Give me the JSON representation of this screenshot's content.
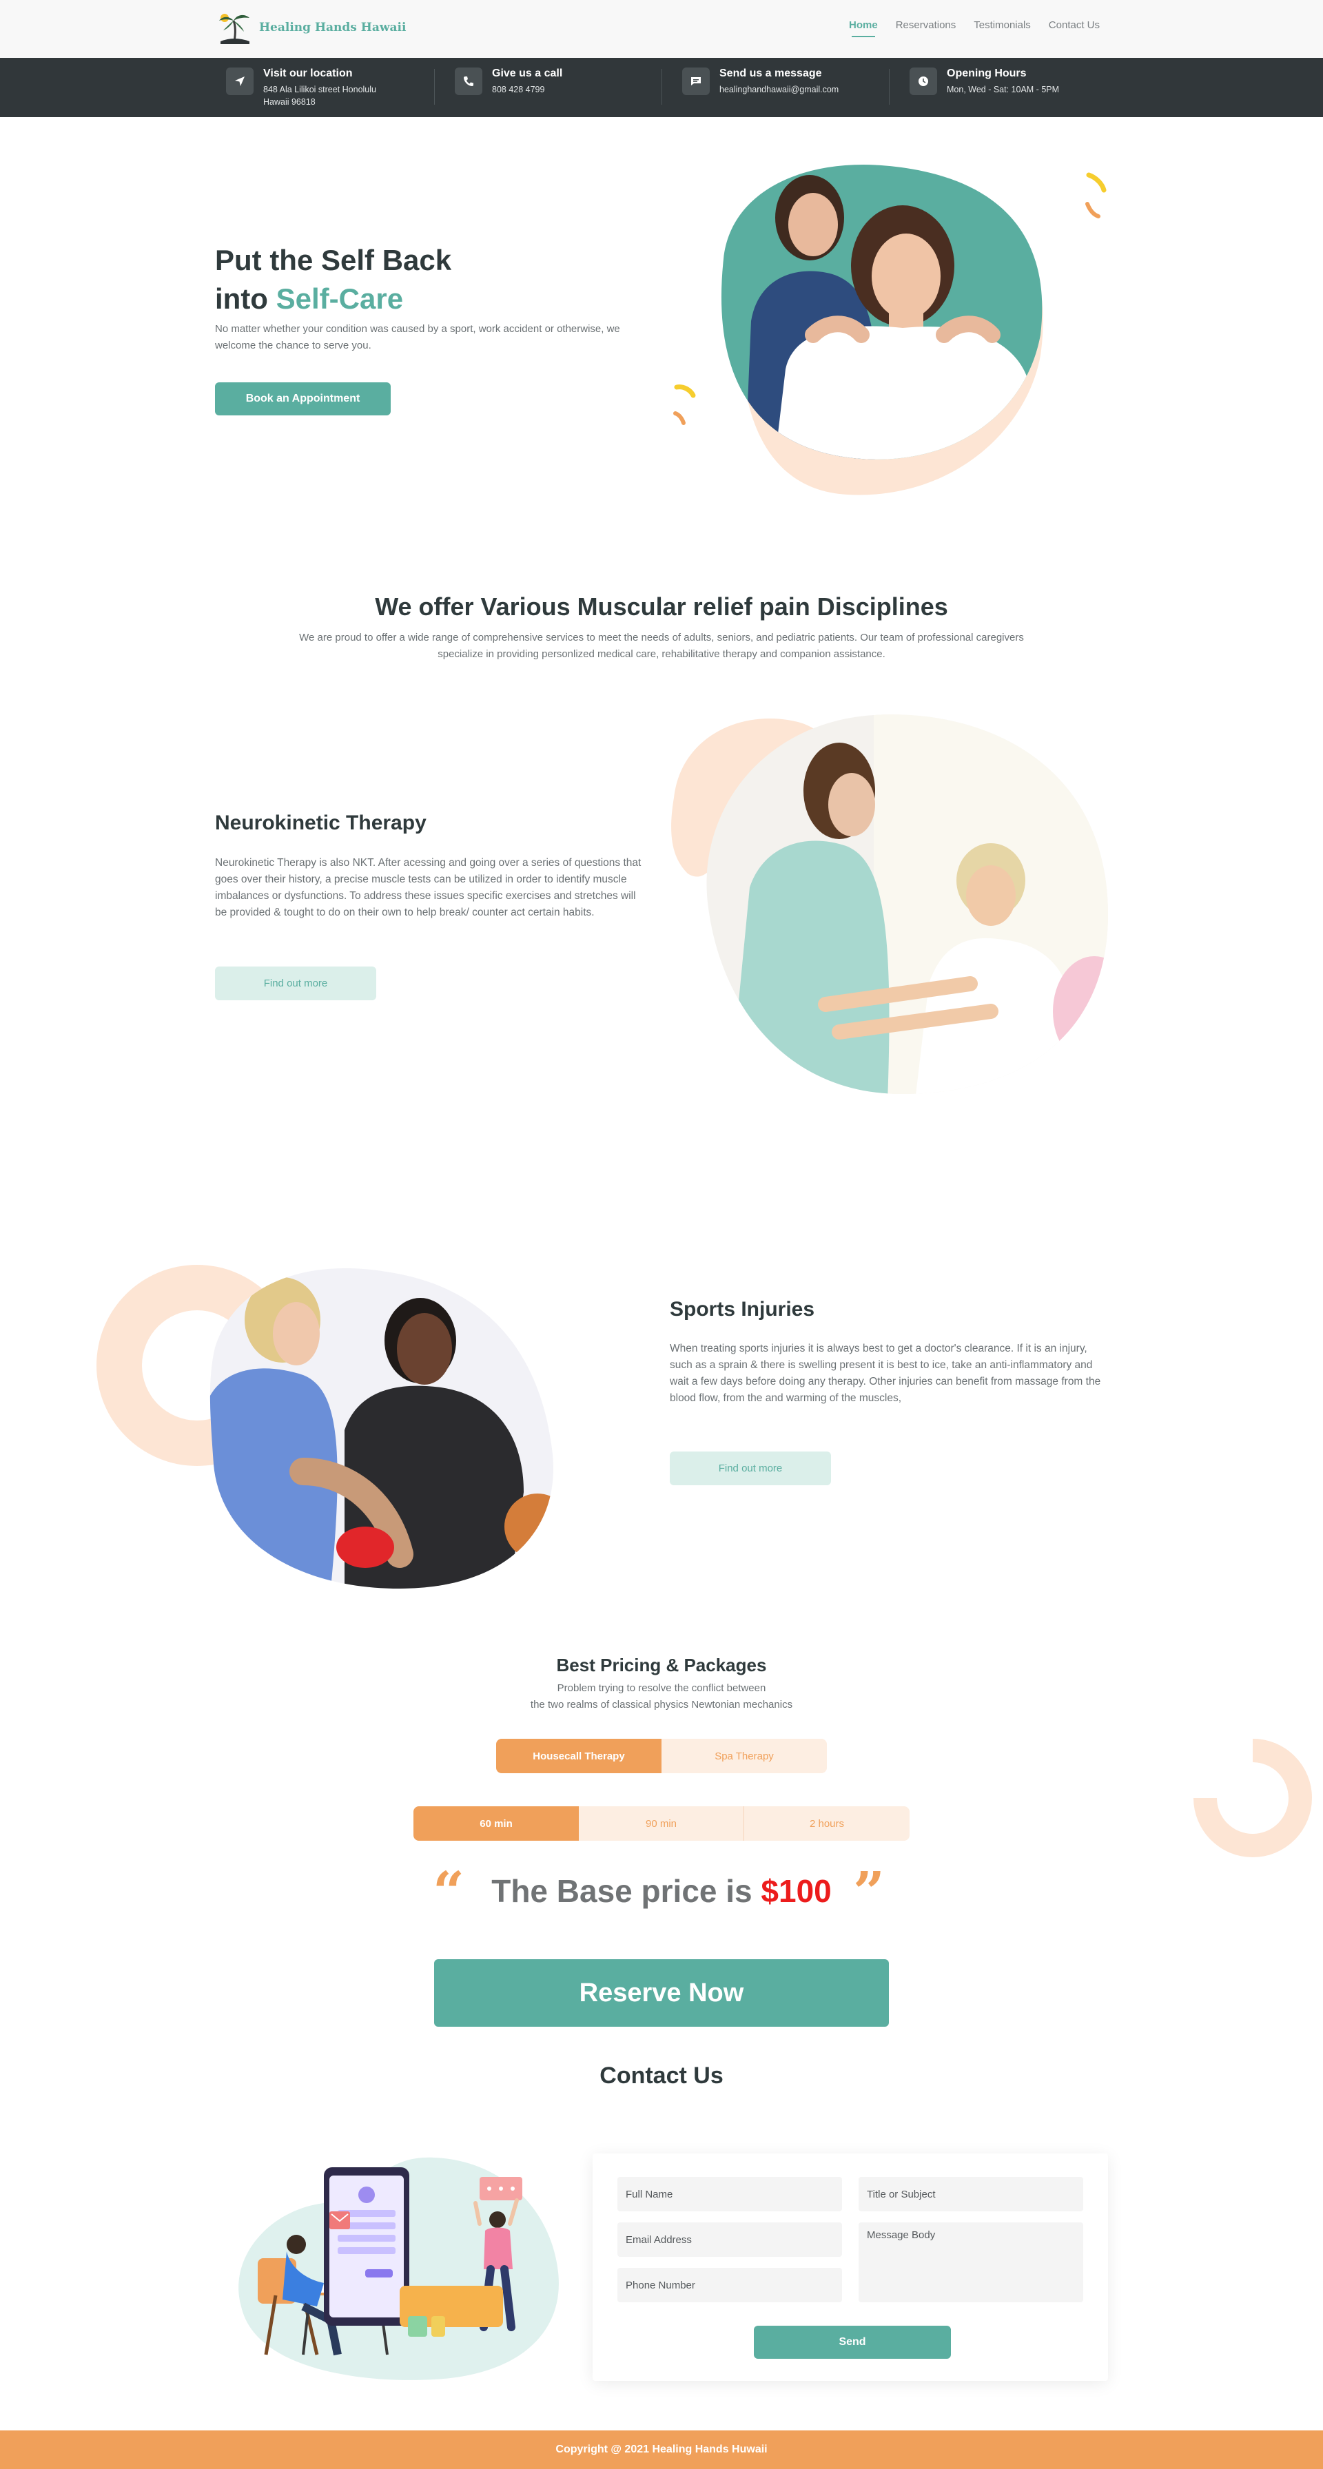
{
  "brand": {
    "name": "Healing Hands Hawaii"
  },
  "nav": {
    "links": [
      {
        "label": "Home",
        "active": true
      },
      {
        "label": "Reservations",
        "active": false
      },
      {
        "label": "Testimonials",
        "active": false
      },
      {
        "label": "Contact Us",
        "active": false
      }
    ]
  },
  "info_bar": [
    {
      "icon": "location-arrow-icon",
      "title": "Visit our location",
      "detail": "848 Ala Lilikoi street Honolulu\nHawaii 96818"
    },
    {
      "icon": "phone-icon",
      "title": "Give us a call",
      "detail": "808 428 4799"
    },
    {
      "icon": "message-icon",
      "title": "Send us a message",
      "detail": "healinghandhawaii@gmail.com"
    },
    {
      "icon": "clock-icon",
      "title": "Opening Hours",
      "detail": "Mon, Wed - Sat: 10AM - 5PM"
    }
  ],
  "hero": {
    "title_line1": "Put the Self Back",
    "title_line2_prefix": "into ",
    "title_line2_accent": "Self-Care",
    "subtitle": "No matter whether your condition was caused by a sport, work accident or otherwise, we welcome the chance to serve you.",
    "cta": "Book an Appointment"
  },
  "disciplines": {
    "title": "We offer Various Muscular relief pain Disciplines",
    "description": "We are proud to offer a wide range of comprehensive services to meet the needs of adults, seniors, and pediatric patients. Our team of professional caregivers specialize in providing personlized medical care, rehabilitative therapy and companion assistance."
  },
  "features": [
    {
      "title": "Neurokinetic Therapy",
      "description": "Neurokinetic Therapy is also NKT. After acessing and going over a series of questions that goes over their history, a precise muscle tests can be utilized in order to identify muscle imbalances or dysfunctions. To address these issues specific exercises and stretches will be provided & tought to do on their own to help break/ counter act certain habits.",
      "cta": "Find out more"
    },
    {
      "title": "Sports Injuries",
      "description": "When treating sports injuries it is always best to get a doctor's clearance. If it is an injury, such as a sprain & there is swelling present it is best to ice, take an anti-inflammatory and wait a few days before doing any therapy. Other injuries can benefit from massage from the blood flow, from the and warming of the muscles,",
      "cta": "Find out more"
    }
  ],
  "pricing": {
    "title": "Best Pricing & Packages",
    "subtitle_line1": "Problem trying to resolve the conflict between",
    "subtitle_line2": "the two realms of classical physics Newtonian mechanics",
    "therapy_tabs": [
      {
        "label": "Housecall Therapy",
        "selected": true
      },
      {
        "label": "Spa Therapy",
        "selected": false
      }
    ],
    "duration_tabs": [
      {
        "label": "60 min",
        "selected": true
      },
      {
        "label": "90 min",
        "selected": false
      },
      {
        "label": "2 hours",
        "selected": false
      }
    ],
    "price_prefix": "The Base price is ",
    "price_value": "$100",
    "quote_open": "“",
    "quote_close": "”",
    "cta": "Reserve Now"
  },
  "contact": {
    "title": "Contact Us",
    "fields": {
      "full_name": "Full Name",
      "title_subject": "Title or Subject",
      "email": "Email Address",
      "message": "Message Body",
      "phone": "Phone Number"
    },
    "send": "Send"
  },
  "footer": {
    "copyright": "Copyright @ 2021 Healing Hands Huwaii"
  },
  "colors": {
    "teal": "#5aaea0",
    "orange": "#f0a05a",
    "dark": "#31373a",
    "peach": "#fde5d4",
    "price_red": "#ec1c1c"
  }
}
